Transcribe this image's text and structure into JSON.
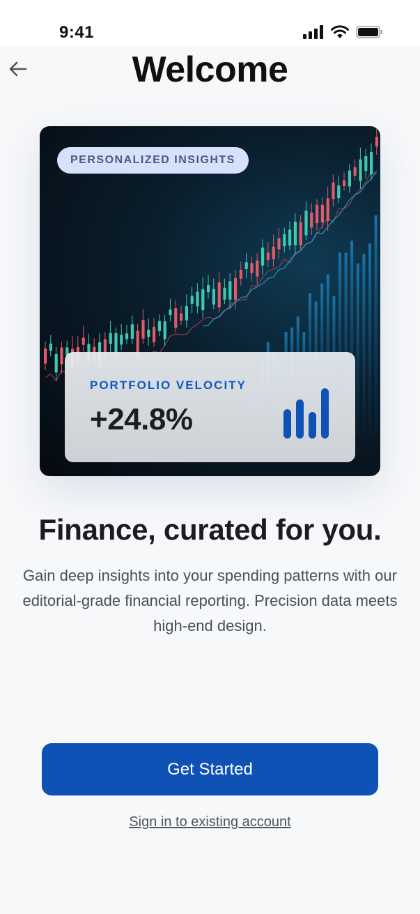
{
  "status_bar": {
    "time": "9:41",
    "icons": [
      "cellular-signal-icon",
      "wifi-icon",
      "battery-icon"
    ]
  },
  "header": {
    "back_icon": "arrow-left-icon",
    "title": "Welcome"
  },
  "hero": {
    "badge": "PERSONALIZED INSIGHTS",
    "metric_label": "PORTFOLIO VELOCITY",
    "metric_value": "+24.8%",
    "metric_icon": "bar-chart-icon"
  },
  "content": {
    "headline": "Finance, curated for you.",
    "description": "Gain deep insights into your spending patterns with our editorial-grade financial reporting. Precision data meets high-end design."
  },
  "actions": {
    "primary_label": "Get Started",
    "secondary_label": "Sign in to existing account"
  },
  "colors": {
    "accent": "#0e52b6",
    "badge_bg": "#d6e2fb",
    "background": "#f7f8fa"
  }
}
